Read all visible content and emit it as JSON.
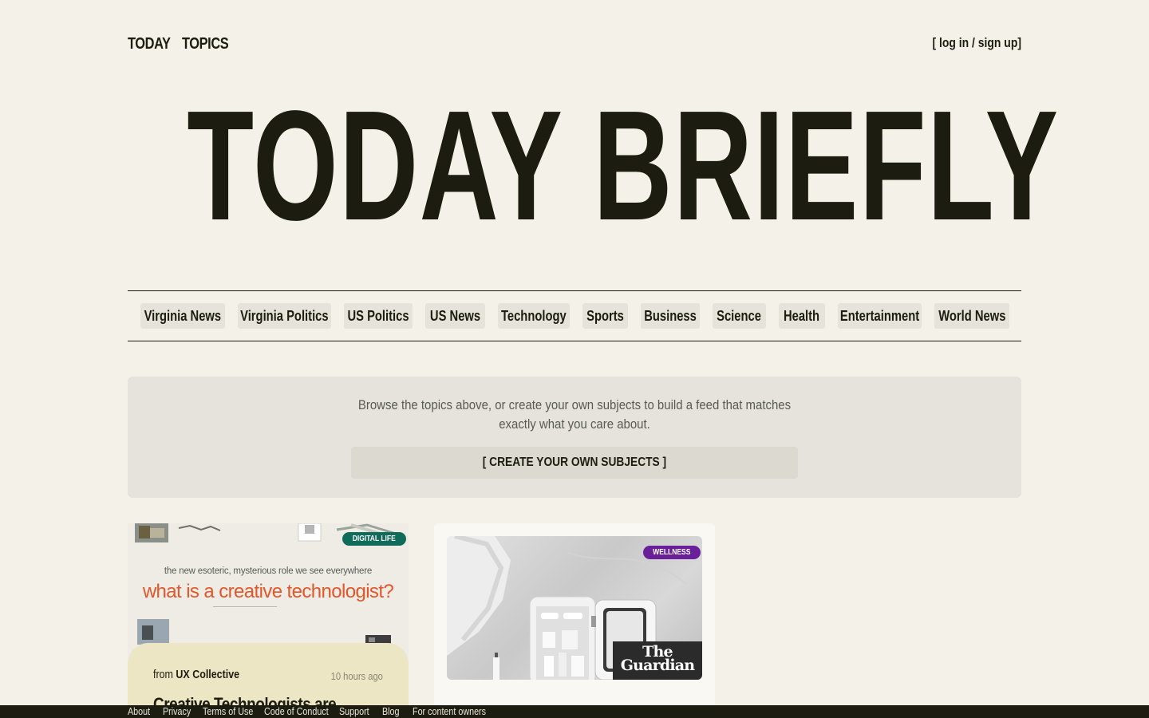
{
  "nav": {
    "today": "TODAY",
    "topics": "TOPICS",
    "auth": "[ log in / sign up]"
  },
  "masthead": {
    "title": "TODAY BRIEFLY"
  },
  "topics": [
    "Virginia News",
    "Virginia Politics",
    "US Politics",
    "US News",
    "Technology",
    "Sports",
    "Business",
    "Science",
    "Health",
    "Entertainment",
    "World News"
  ],
  "promo": {
    "text": "Browse the topics above, or create your own subjects to build a feed that matches exactly what you care about.",
    "button": "[ CREATE YOUR OWN SUBJECTS ]"
  },
  "cards": [
    {
      "badge": "DIGITAL LIFE",
      "badge_color": "#0f6b5a",
      "thumb_subtitle": "the new esoteric, mysterious role we see everywhere",
      "thumb_title": "what is a creative technologist?",
      "from_prefix": "from",
      "source": "UX Collective",
      "time": "10 hours ago",
      "headline": "Creative Technologists are"
    },
    {
      "badge": "WELLNESS",
      "badge_color": "#6a1f9a",
      "publisher_logo_line1": "The",
      "publisher_logo_line2": "Guardian"
    }
  ],
  "footer": [
    "About",
    "Privacy",
    "Terms of Use",
    "Code of Conduct",
    "Support",
    "Blog",
    "For content owners"
  ]
}
